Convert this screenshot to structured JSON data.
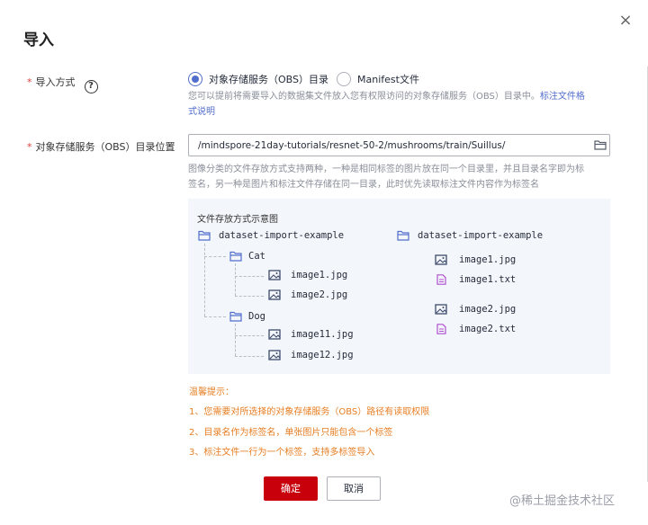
{
  "dialog": {
    "title": "导入",
    "close_symbol": "×"
  },
  "import_method": {
    "label": "导入方式",
    "required_mark": "*",
    "help_symbol": "?",
    "options": [
      {
        "label": "对象存储服务（OBS）目录",
        "selected": true
      },
      {
        "label": "Manifest文件",
        "selected": false
      }
    ],
    "hint_line1_prefix": "您可以提前将需要导入的数据集文件放入您有权限访问的对象存储服务（OBS）目录中。",
    "hint_link_line1": "标注文件格",
    "hint_link_line2": "式说明"
  },
  "obs_location": {
    "label": "对象存储服务（OBS）目录位置",
    "required_mark": "*",
    "value": "/mindspore-21day-tutorials/resnet-50-2/mushrooms/train/Suillus/",
    "folder_icon": "folder-icon",
    "desc_line1": "图像分类的文件存放方式支持两种，一种是相同标签的图片放在同一个目录里，并且目录名字即为标",
    "desc_line2": "签名，另一种是图片和标注文件存储在同一目录，此时优先读取标注文件内容作为标签名"
  },
  "example": {
    "title": "文件存放方式示意图",
    "left_tree": {
      "root": "dataset-import-example",
      "folders": [
        {
          "name": "Cat",
          "files": [
            "image1.jpg",
            "image2.jpg"
          ]
        },
        {
          "name": "Dog",
          "files": [
            "image11.jpg",
            "image12.jpg"
          ]
        }
      ]
    },
    "right_tree": {
      "root": "dataset-import-example",
      "files": [
        "image1.jpg",
        "image1.txt",
        "image2.jpg",
        "image2.txt"
      ]
    }
  },
  "tips": {
    "title": "温馨提示：",
    "items": [
      "1、您需要对所选择的对象存储服务（OBS）路径有读取权限",
      "2、目录名作为标签名，单张图片只能包含一个标签",
      "3、标注文件一行为一个标签，支持多标签导入"
    ]
  },
  "footer": {
    "ok_label": "确定",
    "cancel_label": "取消"
  },
  "watermark": "@稀土掘金技术社区",
  "colors": {
    "primary_button": "#c7000b",
    "accent": "#526ecc",
    "tip_text": "#e67e22",
    "required": "#e0433f"
  }
}
